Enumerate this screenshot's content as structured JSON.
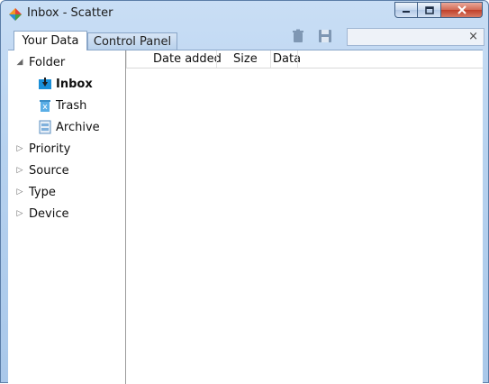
{
  "window": {
    "title": "Inbox - Scatter",
    "buttons": {
      "minimize": "minimize",
      "maximize": "maximize",
      "close": "close"
    }
  },
  "tabs": [
    {
      "label": "Your Data",
      "active": true
    },
    {
      "label": "Control Panel",
      "active": false
    }
  ],
  "toolbar": {
    "delete_icon": "trash-icon",
    "save_icon": "floppy-icon",
    "search_value": "",
    "search_clear": "×"
  },
  "sidebar": {
    "folder": {
      "label": "Folder",
      "expanded": true
    },
    "folder_items": [
      {
        "label": "Inbox",
        "icon": "inbox-icon",
        "selected": true
      },
      {
        "label": "Trash",
        "icon": "trash-bin-icon",
        "selected": false
      },
      {
        "label": "Archive",
        "icon": "archive-icon",
        "selected": false
      }
    ],
    "groups": [
      {
        "label": "Priority",
        "expanded": false
      },
      {
        "label": "Source",
        "expanded": false
      },
      {
        "label": "Type",
        "expanded": false
      },
      {
        "label": "Device",
        "expanded": false
      }
    ]
  },
  "table": {
    "columns": [
      "Date added",
      "Size",
      "Data"
    ],
    "rows": []
  },
  "colors": {
    "accent": "#1a8fd8",
    "frame": "#b7d2ef",
    "close_button": "#c0402a"
  }
}
